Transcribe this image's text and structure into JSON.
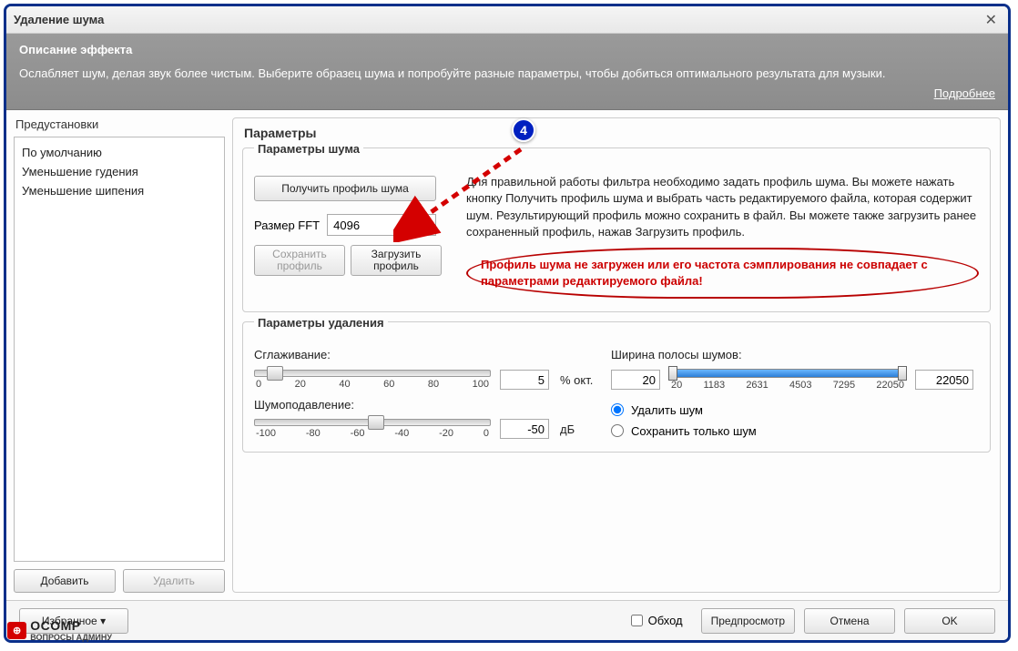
{
  "window": {
    "title": "Удаление шума"
  },
  "description": {
    "heading": "Описание эффекта",
    "text": "Ослабляет шум, делая звук более чистым. Выберите образец шума и попробуйте разные параметры, чтобы добиться оптимального результата для музыки.",
    "more": "Подробнее"
  },
  "presets": {
    "label": "Предустановки",
    "items": [
      "По умолчанию",
      "Уменьшение гудения",
      "Уменьшение шипения"
    ],
    "add": "Добавить",
    "remove": "Удалить"
  },
  "params": {
    "heading": "Параметры",
    "noise": {
      "title": "Параметры шума",
      "get_profile": "Получить профиль шума",
      "fft_label": "Размер FFT",
      "fft_value": "4096",
      "save_profile": "Сохранить профиль",
      "load_profile": "Загрузить профиль",
      "info": "Для правильной работы фильтра необходимо задать профиль шума. Вы можете нажать кнопку Получить профиль шума и выбрать часть редактируемого файла, которая содержит шум. Результирующий профиль можно сохранить в файл. Вы можете также загрузить ранее сохраненный профиль, нажав Загрузить профиль.",
      "warning": "Профиль шума не загружен или его частота сэмплирования не совпадает с параметрами редактируемого файла!"
    },
    "removal": {
      "title": "Параметры удаления",
      "smoothing_label": "Сглаживание:",
      "smoothing_value": "5",
      "smoothing_unit": "% окт.",
      "smoothing_ticks": [
        "0",
        "20",
        "40",
        "60",
        "80",
        "100"
      ],
      "reduce_label": "Шумоподавление:",
      "reduce_value": "-50",
      "reduce_unit": "дБ",
      "reduce_ticks": [
        "-100",
        "-80",
        "-60",
        "-40",
        "-20",
        "0"
      ],
      "band_label": "Ширина полосы шумов:",
      "band_low": "20",
      "band_high": "22050",
      "band_ticks": [
        "20",
        "1183",
        "2631",
        "4503",
        "7295",
        "22050"
      ],
      "radio_remove": "Удалить шум",
      "radio_keep": "Сохранить только шум"
    }
  },
  "footer": {
    "favorites": "Избранное",
    "bypass": "Обход",
    "preview": "Предпросмотр",
    "cancel": "Отмена",
    "ok": "OK"
  },
  "annotation": {
    "number": "4"
  },
  "watermark": {
    "main": "OCOMP",
    "sub": "ВОПРОСЫ АДМИНУ"
  }
}
